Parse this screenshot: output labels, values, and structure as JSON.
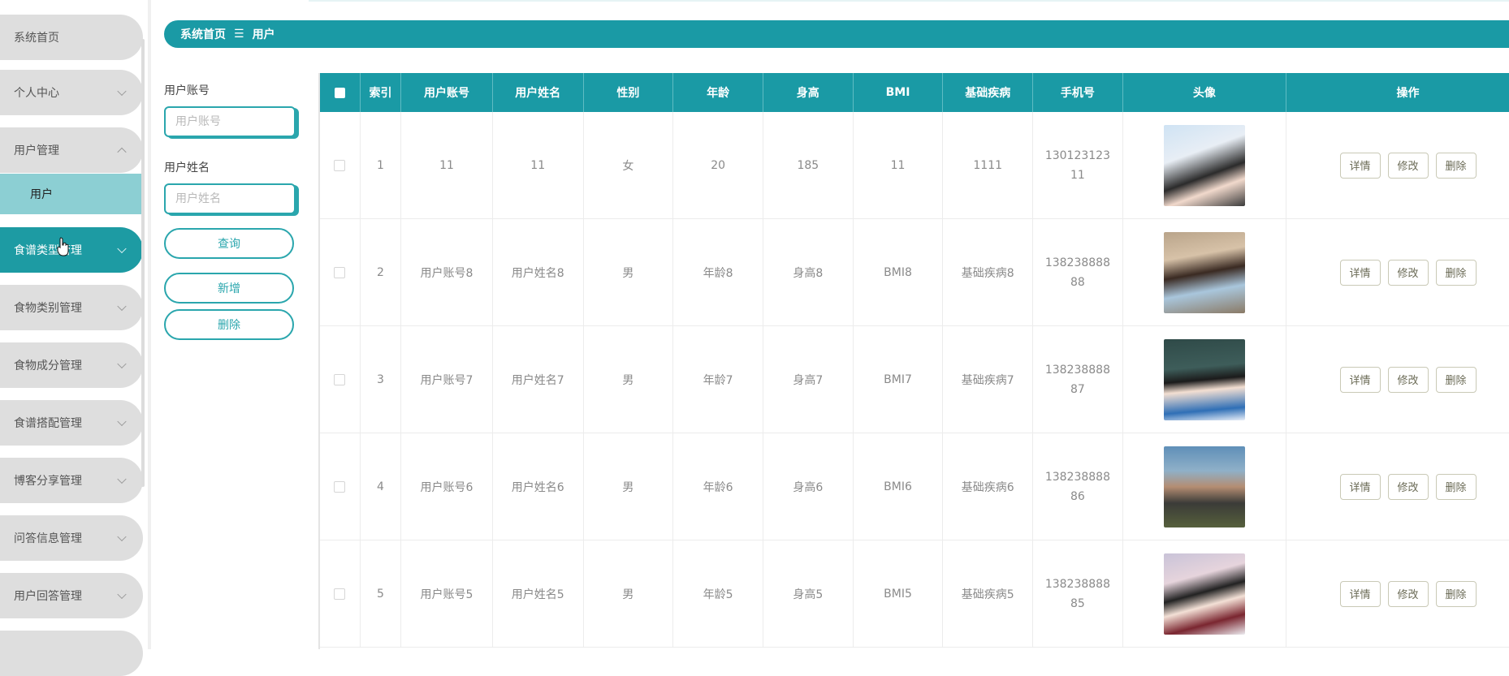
{
  "sidebar": {
    "items": [
      {
        "label": "系统首页",
        "chevron": false
      },
      {
        "label": "个人中心",
        "chevron": true
      },
      {
        "label": "用户管理",
        "chevron": true,
        "expanded": true
      },
      {
        "label": "食谱类型管理",
        "chevron": true,
        "active": true
      },
      {
        "label": "食物类别管理",
        "chevron": true
      },
      {
        "label": "食物成分管理",
        "chevron": true
      },
      {
        "label": "食谱搭配管理",
        "chevron": true
      },
      {
        "label": "博客分享管理",
        "chevron": true
      },
      {
        "label": "问答信息管理",
        "chevron": true
      },
      {
        "label": "用户回答管理",
        "chevron": true
      }
    ],
    "sub_item": "用户"
  },
  "breadcrumb": {
    "home": "系统首页",
    "separator": "☰",
    "current": "用户"
  },
  "search": {
    "account_label": "用户账号",
    "account_placeholder": "用户账号",
    "name_label": "用户姓名",
    "name_placeholder": "用户姓名",
    "query_label": "查询",
    "add_label": "新增",
    "delete_label": "删除"
  },
  "table": {
    "columns": [
      "",
      "索引",
      "用户账号",
      "用户姓名",
      "性别",
      "年龄",
      "身高",
      "BMI",
      "基础疾病",
      "手机号",
      "头像",
      "操作"
    ],
    "rows": [
      {
        "index": "1",
        "account": "11",
        "name": "11",
        "gender": "女",
        "age": "20",
        "height": "185",
        "bmi": "11",
        "disease": "1111",
        "phone": "13012312311"
      },
      {
        "index": "2",
        "account": "用户账号8",
        "name": "用户姓名8",
        "gender": "男",
        "age": "年龄8",
        "height": "身高8",
        "bmi": "BMI8",
        "disease": "基础疾病8",
        "phone": "13823888888"
      },
      {
        "index": "3",
        "account": "用户账号7",
        "name": "用户姓名7",
        "gender": "男",
        "age": "年龄7",
        "height": "身高7",
        "bmi": "BMI7",
        "disease": "基础疾病7",
        "phone": "13823888887"
      },
      {
        "index": "4",
        "account": "用户账号6",
        "name": "用户姓名6",
        "gender": "男",
        "age": "年龄6",
        "height": "身高6",
        "bmi": "BMI6",
        "disease": "基础疾病6",
        "phone": "13823888886"
      },
      {
        "index": "5",
        "account": "用户账号5",
        "name": "用户姓名5",
        "gender": "男",
        "age": "年龄5",
        "height": "身高5",
        "bmi": "BMI5",
        "disease": "基础疾病5",
        "phone": "13823888885"
      }
    ],
    "actions": {
      "detail": "详情",
      "edit": "修改",
      "delete": "删除"
    }
  },
  "colors": {
    "accent": "#1a9aa5",
    "active_menu": "#1d9ba3",
    "submenu": "#8ccfd3",
    "menu_bg": "#dedede"
  },
  "icons": {
    "cursor": "hand-cursor-icon",
    "chevron": "chevron-down-icon",
    "breadcrumb_separator": "menu-icon"
  }
}
